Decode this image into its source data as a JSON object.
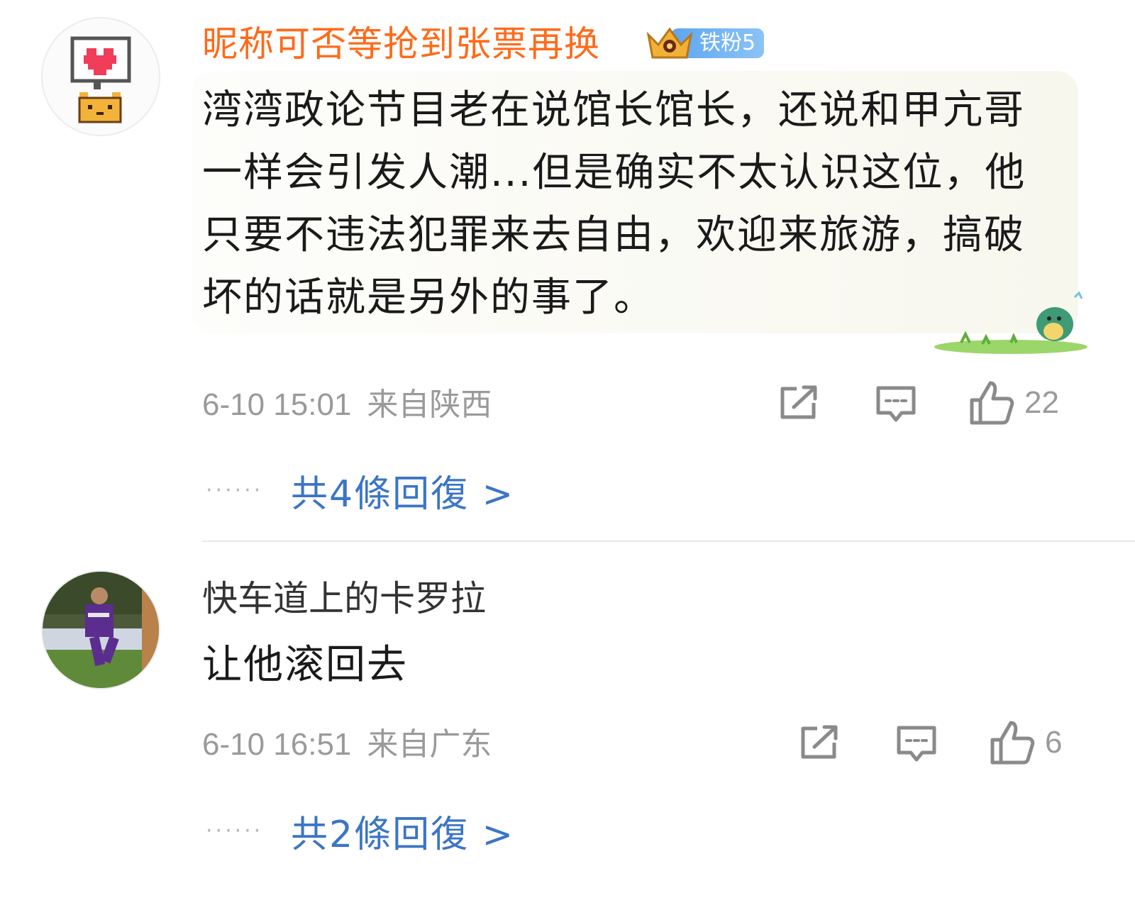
{
  "comments": [
    {
      "username": "昵称可否等抢到张票再换",
      "badge": "铁粉5",
      "text": "湾湾政论节目老在说馆长馆长，还说和甲亢哥一样会引发人潮...但是确实不太认识这位，他只要不违法犯罪来去自由，欢迎来旅游，搞破坏的话就是另外的事了。",
      "date": "6-10 15:01",
      "location": "来自陕西",
      "likes": "22",
      "replies": "共4條回復 >"
    },
    {
      "username": "快车道上的卡罗拉",
      "text": "让他滚回去",
      "date": "6-10 16:51",
      "location": "来自广东",
      "likes": "6",
      "replies": "共2條回復 >"
    }
  ],
  "colors": {
    "vip_name": "#ff6a1a",
    "link": "#3b75c6",
    "meta": "#9a9a9a",
    "badge": "#5ea6f0"
  },
  "icons": [
    "share-icon",
    "comment-icon",
    "like-icon",
    "crown-icon"
  ]
}
